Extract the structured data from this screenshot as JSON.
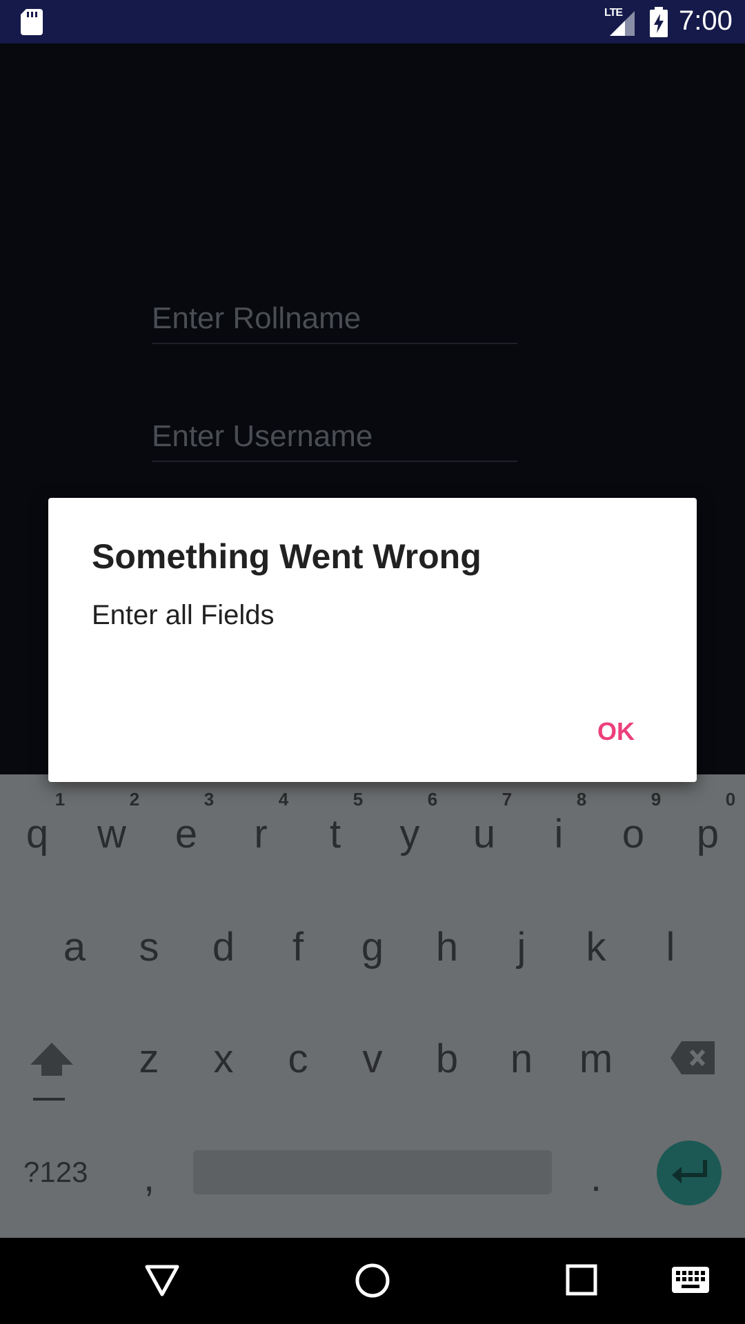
{
  "status_bar": {
    "time": "7:00",
    "network": "LTE"
  },
  "form": {
    "rollname_placeholder": "Enter Rollname",
    "username_placeholder": "Enter Username"
  },
  "dialog": {
    "title": "Something Went Wrong",
    "message": "Enter all Fields",
    "ok_label": "OK"
  },
  "keyboard": {
    "row1": [
      "q",
      "w",
      "e",
      "r",
      "t",
      "y",
      "u",
      "i",
      "o",
      "p"
    ],
    "row1_hints": [
      "1",
      "2",
      "3",
      "4",
      "5",
      "6",
      "7",
      "8",
      "9",
      "0"
    ],
    "row2": [
      "a",
      "s",
      "d",
      "f",
      "g",
      "h",
      "j",
      "k",
      "l"
    ],
    "row3": [
      "z",
      "x",
      "c",
      "v",
      "b",
      "n",
      "m"
    ],
    "symbols_label": "?123",
    "comma": ",",
    "period": "."
  },
  "colors": {
    "accent": "#ec3f7c",
    "status_bar": "#151a4a",
    "enter_key": "#1c5955"
  }
}
